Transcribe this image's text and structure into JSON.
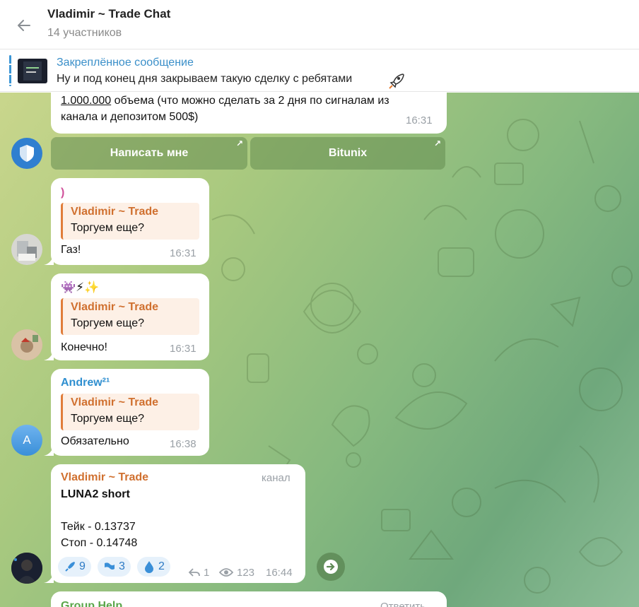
{
  "header": {
    "title": "Vladimir ~ Trade Chat",
    "subtitle": "14 участников"
  },
  "pinned": {
    "label": "Закреплённое сообщение",
    "text": "Ну и под конец дня закрываем такую сделку с ребятами"
  },
  "messages": {
    "m1": {
      "line1_link": "1.000.000",
      "line1_rest": " объема (что можно сделать за 2 дня по сигналам из",
      "line2": "канала и депозитом 500$)",
      "time": "16:31",
      "buttons": [
        "Написать мне",
        "Bitunix"
      ]
    },
    "m2": {
      "sender": ")",
      "quote_name": "Vladimir ~ Trade",
      "quote_text": "Торгуем еще?",
      "text": "Газ!",
      "time": "16:31"
    },
    "m3": {
      "emoji": "👾⚡✨",
      "quote_name": "Vladimir ~ Trade",
      "quote_text": "Торгуем еще?",
      "text": "Конечно!",
      "time": "16:31"
    },
    "m4": {
      "sender": "Andrew²¹",
      "avatar_letter": "A",
      "quote_name": "Vladimir ~ Trade",
      "quote_text": "Торгуем еще?",
      "text": "Обязательно",
      "time": "16:38"
    },
    "m5": {
      "sender": "Vladimir ~ Trade",
      "channel_tag": "канал",
      "title": "LUNA2 short",
      "line1": "Тейк - 0.13737",
      "line2": "Стоп - 0.14748",
      "reactions": [
        {
          "icon": "rocket-icon",
          "count": "9"
        },
        {
          "icon": "flag-icon",
          "count": "3"
        },
        {
          "icon": "drop-icon",
          "count": "2"
        }
      ],
      "replies": "1",
      "views": "123",
      "time": "16:44"
    },
    "m6": {
      "sender": "Group Help",
      "action": "Ответить"
    }
  },
  "colors": {
    "accent": "#3a8fc9",
    "quote_name": "#d0702f",
    "sender_blue": "#2f8fd0",
    "sender_green": "#5aa64a"
  }
}
